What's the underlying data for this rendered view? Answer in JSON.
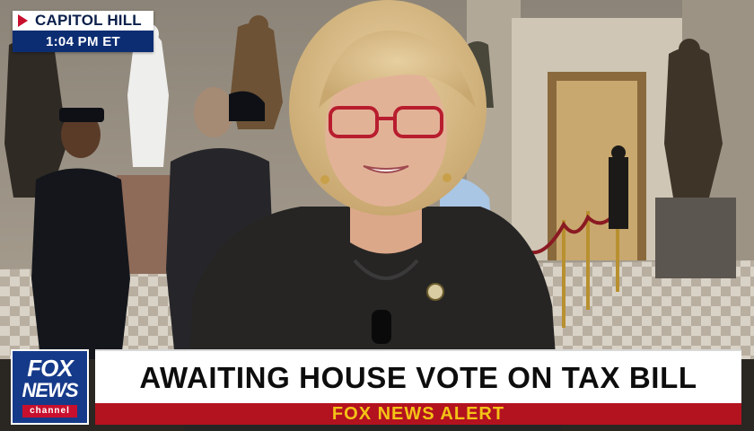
{
  "location_bug": {
    "place": "CAPITOL HILL",
    "time": "1:04 PM ET"
  },
  "network_logo": {
    "line1": "FOX",
    "line2": "NEWS",
    "line3": "channel"
  },
  "lower_third": {
    "headline": "AWAITING HOUSE VOTE ON TAX BILL",
    "alert": "FOX NEWS ALERT"
  },
  "colors": {
    "brand_navy": "#0d2d73",
    "alert_red": "#b3121f",
    "alert_text_yellow": "#f3c316"
  }
}
